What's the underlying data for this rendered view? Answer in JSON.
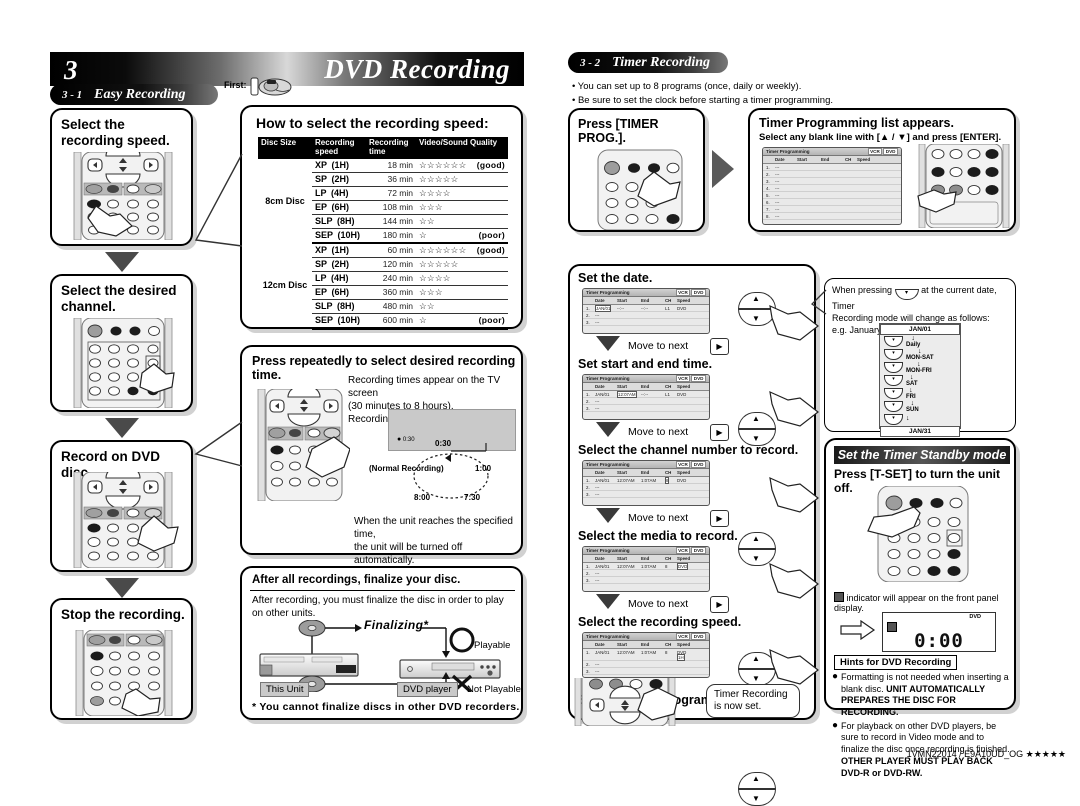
{
  "header": {
    "chapter_number": "3",
    "chapter_title": "DVD Recording",
    "section_1_num": "3 - 1",
    "section_1_title": "Easy Recording",
    "section_2_num": "3 - 2",
    "section_2_title": "Timer Recording",
    "first_label": "First:"
  },
  "timer_intro": {
    "bullet_1": "You can set up to 8 programs (once, daily or weekly).",
    "bullet_2": "Be sure to set the clock before starting a timer programming."
  },
  "easy_steps": {
    "step1": "Select the recording speed.",
    "step2": "Select the desired channel.",
    "step3": "Record on DVD disc.",
    "step4": "Stop the recording."
  },
  "speed_panel": {
    "title": "How to select the recording speed:",
    "columns": [
      "Disc Size",
      "Recording speed",
      "Recording time",
      "Video/Sound Quality"
    ],
    "good_label": "(good)",
    "poor_label": "(poor)",
    "groups": [
      {
        "disc": "8cm Disc",
        "rows": [
          {
            "speed": "XP",
            "hours": "(1H)",
            "time": "18 min",
            "stars": "☆☆☆☆☆☆",
            "note": "(good)"
          },
          {
            "speed": "SP",
            "hours": "(2H)",
            "time": "36 min",
            "stars": "☆☆☆☆☆",
            "note": ""
          },
          {
            "speed": "LP",
            "hours": "(4H)",
            "time": "72 min",
            "stars": "☆☆☆☆",
            "note": ""
          },
          {
            "speed": "EP",
            "hours": "(6H)",
            "time": "108 min",
            "stars": "☆☆☆",
            "note": ""
          },
          {
            "speed": "SLP",
            "hours": "(8H)",
            "time": "144 min",
            "stars": "☆☆",
            "note": ""
          },
          {
            "speed": "SEP",
            "hours": "(10H)",
            "time": "180 min",
            "stars": "☆",
            "note": "(poor)"
          }
        ]
      },
      {
        "disc": "12cm Disc",
        "rows": [
          {
            "speed": "XP",
            "hours": "(1H)",
            "time": "60 min",
            "stars": "☆☆☆☆☆☆",
            "note": "(good)"
          },
          {
            "speed": "SP",
            "hours": "(2H)",
            "time": "120 min",
            "stars": "☆☆☆☆☆",
            "note": ""
          },
          {
            "speed": "LP",
            "hours": "(4H)",
            "time": "240 min",
            "stars": "☆☆☆☆",
            "note": ""
          },
          {
            "speed": "EP",
            "hours": "(6H)",
            "time": "360 min",
            "stars": "☆☆☆",
            "note": ""
          },
          {
            "speed": "SLP",
            "hours": "(8H)",
            "time": "480 min",
            "stars": "☆☆",
            "note": ""
          },
          {
            "speed": "SEP",
            "hours": "(10H)",
            "time": "600 min",
            "stars": "☆",
            "note": "(poor)"
          }
        ]
      }
    ]
  },
  "rec_time_panel": {
    "title": "Press repeatedly to select desired recording time.",
    "line1": "Recording times appear on the TV screen",
    "line2": "(30 minutes to 8 hours).",
    "line3": "Recording will start.",
    "osd_value": "0:30",
    "cycle": [
      "0:30",
      "1:00",
      "7:30",
      "8:00"
    ],
    "normal_label": "(Normal Recording)",
    "footer1": "When the unit reaches the specified time,",
    "footer2": "the unit will be turned off automatically."
  },
  "finalize_panel": {
    "title": "After all recordings, finalize your disc.",
    "body": "After recording, you must finalize the disc in order to play on other units.",
    "finalizing_label": "Finalizing*",
    "this_unit": "This Unit",
    "dvd_player": "DVD player",
    "playable": "Playable",
    "not_playable": "Not Playable",
    "note": "* You cannot finalize discs in other DVD recorders."
  },
  "timer_steps": {
    "press_timer_prog": "Press [TIMER PROG.].",
    "list_title": "Timer Programming list appears.",
    "list_sub": "Select any blank line with [▲ / ▼] and press [ENTER].",
    "set_date": "Set the date.",
    "set_start_end": "Set start and end time.",
    "select_channel": "Select the channel number to record.",
    "select_media": "Select the media to record.",
    "select_speed": "Select the recording speed.",
    "set_program": "Set the Timer Program.",
    "move_to_next": "Move to next",
    "confirm_line1": "Timer Recording",
    "confirm_line2": "is now set."
  },
  "timer_screen": {
    "title": "Timer Programming",
    "badge_vcr": "VCR",
    "badge_dvd": "DVD",
    "columns": [
      "Date",
      "Start",
      "End",
      "CH",
      "Speed"
    ],
    "empty_mark": "---",
    "rows_blank": [
      "1.",
      "2.",
      "3.",
      "4.",
      "5.",
      "6.",
      "7.",
      "8."
    ],
    "stage_date": {
      "n": "1.",
      "date": "JAN/01",
      "start": "--:--",
      "end": "--:--",
      "ch": "L1",
      "media": "DVD",
      "speed": ""
    },
    "stage_time": {
      "n": "1.",
      "date": "JAN/01",
      "start": "12:07AM",
      "end": "--:--",
      "ch": "L1",
      "media": "DVD",
      "speed": ""
    },
    "stage_channel": {
      "n": "1.",
      "date": "JAN/01",
      "start": "12:07AM",
      "end": "1:07AM",
      "ch": "8",
      "media": "DVD",
      "speed": ""
    },
    "stage_media": {
      "n": "1.",
      "date": "JAN/01",
      "start": "12:07AM",
      "end": "1:07AM",
      "ch": "8",
      "media": "DVD",
      "speed": ""
    },
    "stage_speed": {
      "n": "1.",
      "date": "JAN/01",
      "start": "12:07AM",
      "end": "1:07AM",
      "ch": "8",
      "media": "DVD",
      "speed": "1H"
    }
  },
  "date_note": {
    "line1_a": "When pressing",
    "line1_b": "at the current date, Timer",
    "line2": "Recording mode will change as follows:",
    "line3": "e.g. January 1st at present",
    "cycle_start": "JAN/01",
    "cycle_items": [
      "Daily",
      "MON-SAT",
      "MON-FRI",
      "SAT",
      "FRI",
      "SUN"
    ],
    "cycle_end": "JAN/31"
  },
  "standby": {
    "header": "Set the Timer Standby mode",
    "instruction": "Press [T-SET] to turn the unit off.",
    "indicator_note": "indicator will appear on the front panel display.",
    "display_clock": "0:00",
    "display_dvd": "DVD"
  },
  "hints": {
    "title": "Hints for DVD Recording",
    "item1_normal": "Formatting is not needed when inserting a blank disc. ",
    "item1_bold": "UNIT AUTOMATICALLY PREPARES THE DISC FOR RECORDING.",
    "item2_normal": "For playback on other DVD players, be sure to record in Video mode and to finalize the disc once recording is finished. ",
    "item2_bold": "OTHER PLAYER MUST PLAY BACK DVD-R or DVD-RW."
  },
  "footer": {
    "code": "1VMN22014 / E9A10UD_OG ★★★★★"
  }
}
